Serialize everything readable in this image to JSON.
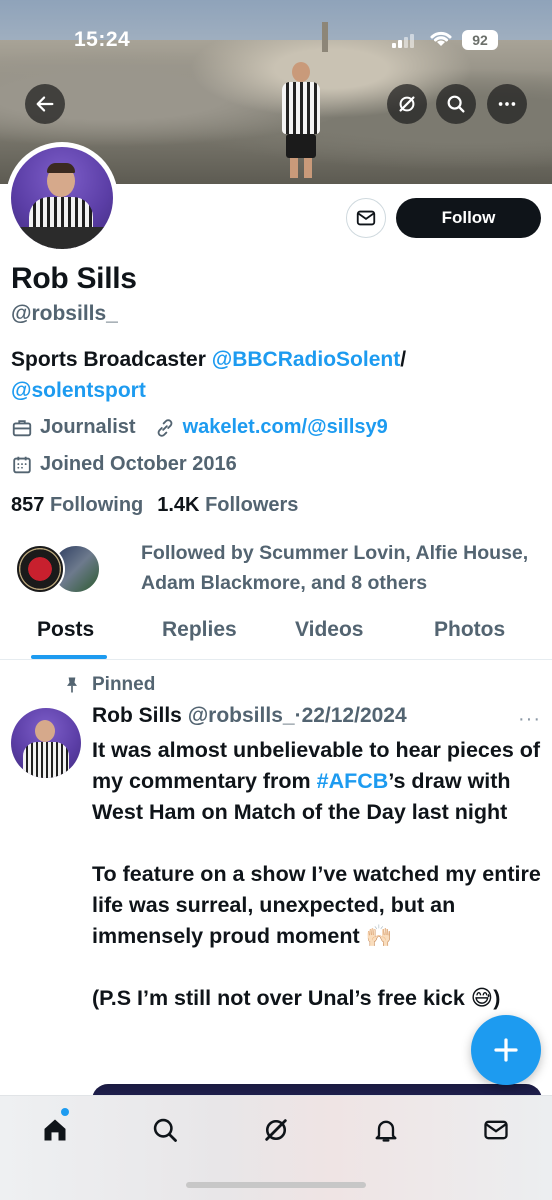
{
  "status_bar": {
    "time": "15:24",
    "battery": "92"
  },
  "header": {
    "back_icon": "back-arrow-icon",
    "grok_icon": "grok-icon",
    "search_icon": "search-icon",
    "more_icon": "more-icon"
  },
  "actions": {
    "message_icon": "mail-icon",
    "follow_label": "Follow"
  },
  "profile": {
    "name": "Rob Sills",
    "handle": "@robsills_",
    "bio_text": "Sports Broadcaster ",
    "bio_link1": "@BBCRadioSolent",
    "bio_sep": "/",
    "bio_link2": "@solentsport",
    "job": "Journalist",
    "website": "wakelet.com/@sillsy9",
    "joined": "Joined October 2016",
    "following_count": "857",
    "following_label": "Following",
    "followers_count": "1.4K",
    "followers_label": "Followers",
    "followed_by": "Followed by Scummer Lovin, Alfie House, Adam Blackmore, and 8 others"
  },
  "tabs": [
    {
      "label": "Posts",
      "active": true
    },
    {
      "label": "Replies",
      "active": false
    },
    {
      "label": "Videos",
      "active": false
    },
    {
      "label": "Photos",
      "active": false
    }
  ],
  "post": {
    "pinned_label": "Pinned",
    "author_name": "Rob Sills",
    "author_handle": "@robsills_",
    "separator": "·",
    "date": "22/12/2024",
    "more": "···",
    "body_line1": "It was almost unbelievable to hear pieces of my commentary from ",
    "body_hashtag": "#AFCB",
    "body_line2": "’s draw with West Ham on Match of the Day last night\n\nTo feature on a show I’ve watched my entire life was surreal, unexpected, but an immensely proud moment 🙌🏻\n\n(P.S I’m still not over Unal’s free kick 😅)"
  },
  "fab": {
    "icon": "plus-icon"
  },
  "bottom_nav": [
    "home-icon",
    "search-icon",
    "grok-icon",
    "notifications-icon",
    "messages-icon"
  ],
  "colors": {
    "accent": "#1d9bf0",
    "text": "#0f1419",
    "muted": "#536471"
  }
}
